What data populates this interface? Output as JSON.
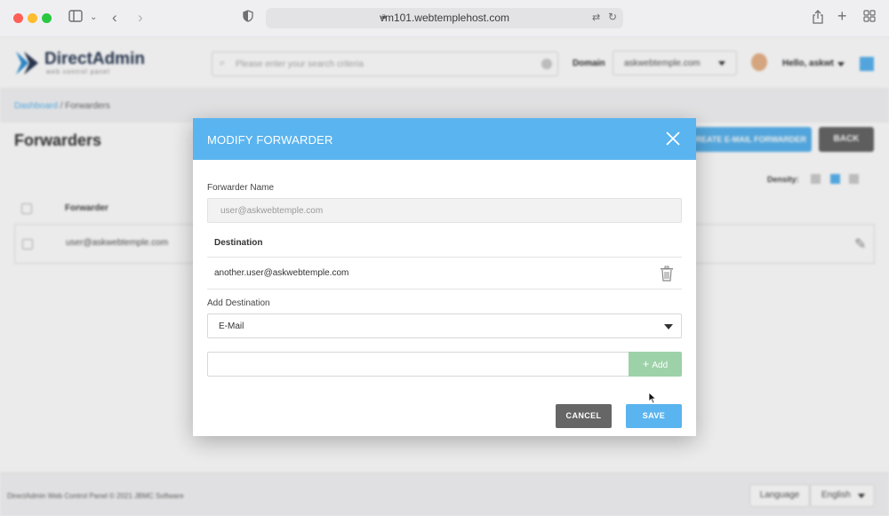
{
  "browser": {
    "url": "vm101.webtemplehost.com"
  },
  "app": {
    "logo_name": "DirectAdmin",
    "logo_tagline": "web control panel",
    "search_placeholder": "Please enter your search criteria",
    "domain_label": "Domain",
    "domain_value": "askwebtemple.com",
    "greeting": "Hello, askwt"
  },
  "breadcrumb": {
    "home": "Dashboard",
    "separator": " / ",
    "current": "Forwarders"
  },
  "page": {
    "title": "Forwarders",
    "create_button": "CREATE E-MAIL FORWARDER",
    "back_button": "BACK",
    "density_label": "Density:",
    "table": {
      "header_forwarder": "Forwarder",
      "rows": [
        {
          "forwarder": "user@askwebtemple.com"
        }
      ]
    }
  },
  "footer": {
    "copyright": "DirectAdmin Web Control Panel © 2021 JBMC Software",
    "language_button": "Language",
    "language_value": "English"
  },
  "modal": {
    "title": "MODIFY FORWARDER",
    "forwarder_name_label": "Forwarder Name",
    "forwarder_name_value": "user@askwebtemple.com",
    "destination_header": "Destination",
    "destinations": [
      "another.user@askwebtemple.com"
    ],
    "add_destination_label": "Add Destination",
    "destination_type": "E-Mail",
    "add_input_value": "",
    "add_button": "Add",
    "cancel_button": "CANCEL",
    "save_button": "SAVE"
  },
  "colors": {
    "accent": "#5ab4ef",
    "add_button": "#9dd1a8",
    "cancel": "#666666"
  }
}
